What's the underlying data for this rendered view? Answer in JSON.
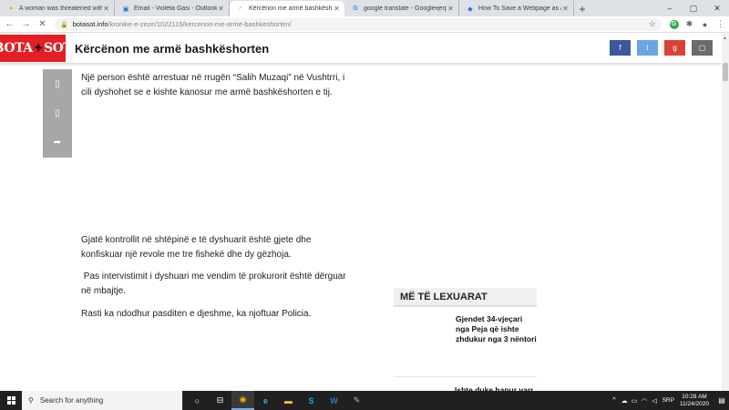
{
  "browser": {
    "tabs": [
      {
        "title": "A woman was threatened with a",
        "icon": "chrome-page-icon",
        "color": "#f4b400",
        "active": false
      },
      {
        "title": "Email - Violeta Gasi - Outlook",
        "icon": "outlook-icon",
        "color": "#0078d4",
        "active": false
      },
      {
        "title": "Kërcënon me armë bashkëshorte",
        "icon": "loading-icon",
        "color": "#1a73e8",
        "active": true
      },
      {
        "title": "google translate - Googleңerp",
        "icon": "google-icon",
        "color": "#4285f4",
        "active": false
      },
      {
        "title": "How To Save a Webpage as a PD",
        "icon": "page-icon",
        "color": "#1a73e8",
        "active": false
      }
    ],
    "new_tab": "+",
    "window_controls": {
      "minimize": "–",
      "maximize": "▢",
      "close": "✕"
    },
    "address": {
      "host": "botasot.info",
      "path": "/kronike-e-zeze/1022115/kercenon-me-arme-bashkeshorten/",
      "lock": "🔒",
      "star": "☆"
    },
    "nav": {
      "back": "←",
      "forward": "→",
      "stop": "✕"
    },
    "ext_g": "G"
  },
  "site": {
    "logo_left": "BOTA",
    "logo_right": "SOT",
    "logo_color": "#e31e24",
    "article_title": "Kërcënon me armë bashkëshorten",
    "share_buttons": [
      {
        "name": "facebook-icon",
        "glyph": "f",
        "color": "#3b5998"
      },
      {
        "name": "twitter-icon",
        "glyph": "t",
        "color": "#6aa6e6"
      },
      {
        "name": "google-plus-icon",
        "glyph": "g",
        "color": "#d94337"
      },
      {
        "name": "more-share-icon",
        "glyph": "▢",
        "color": "#6b6b6b"
      }
    ],
    "side_share": [
      {
        "name": "facebook-side-icon",
        "glyph": "▯"
      },
      {
        "name": "twitter-side-icon",
        "glyph": "▯"
      },
      {
        "name": "share-arrow-icon",
        "glyph": "➦"
      }
    ]
  },
  "article": {
    "p1": "Një person është arrestuar në rrugën “Salih Muzaqi” në Vushtrri, i cili dyshohet se e kishte kanosur me armë bashkëshorten e tij.",
    "p2": "Gjatë kontrollit në shtëpinë e të dyshuarit është gjete dhe konfiskuar një revole me tre fishekë dhe dy gëzhoja.",
    "p3": " Pas intervistimit i dyshuari me vendim të prokurorit është dërguar në mbajtje.",
    "p4": "Rasti ka ndodhur pasditen e djeshme, ka njoftuar Policia."
  },
  "most_read": {
    "heading": "MË TË LEXUARAT",
    "items": [
      {
        "title": "Gjendet 34-vjeçari nga Peja që ishte zhdukur nga 3 nëntori"
      },
      {
        "title": "Ishte duke hapur varr"
      }
    ]
  },
  "taskbar": {
    "search_placeholder": "Search for anything",
    "apps": [
      {
        "name": "task-view-icon",
        "glyph": "○",
        "active": false
      },
      {
        "name": "timeline-icon",
        "glyph": "⊟",
        "active": false
      },
      {
        "name": "chrome-taskbar-icon",
        "glyph": "◉",
        "active": true
      },
      {
        "name": "edge-icon",
        "glyph": "e",
        "active": false
      },
      {
        "name": "file-explorer-icon",
        "glyph": "▬",
        "active": false
      },
      {
        "name": "skype-icon",
        "glyph": "S",
        "active": false
      },
      {
        "name": "word-icon",
        "glyph": "W",
        "active": false
      },
      {
        "name": "app-icon",
        "glyph": "✎",
        "active": false
      }
    ],
    "language": "SRP",
    "time": "10:28 AM",
    "date": "11/24/2020"
  }
}
